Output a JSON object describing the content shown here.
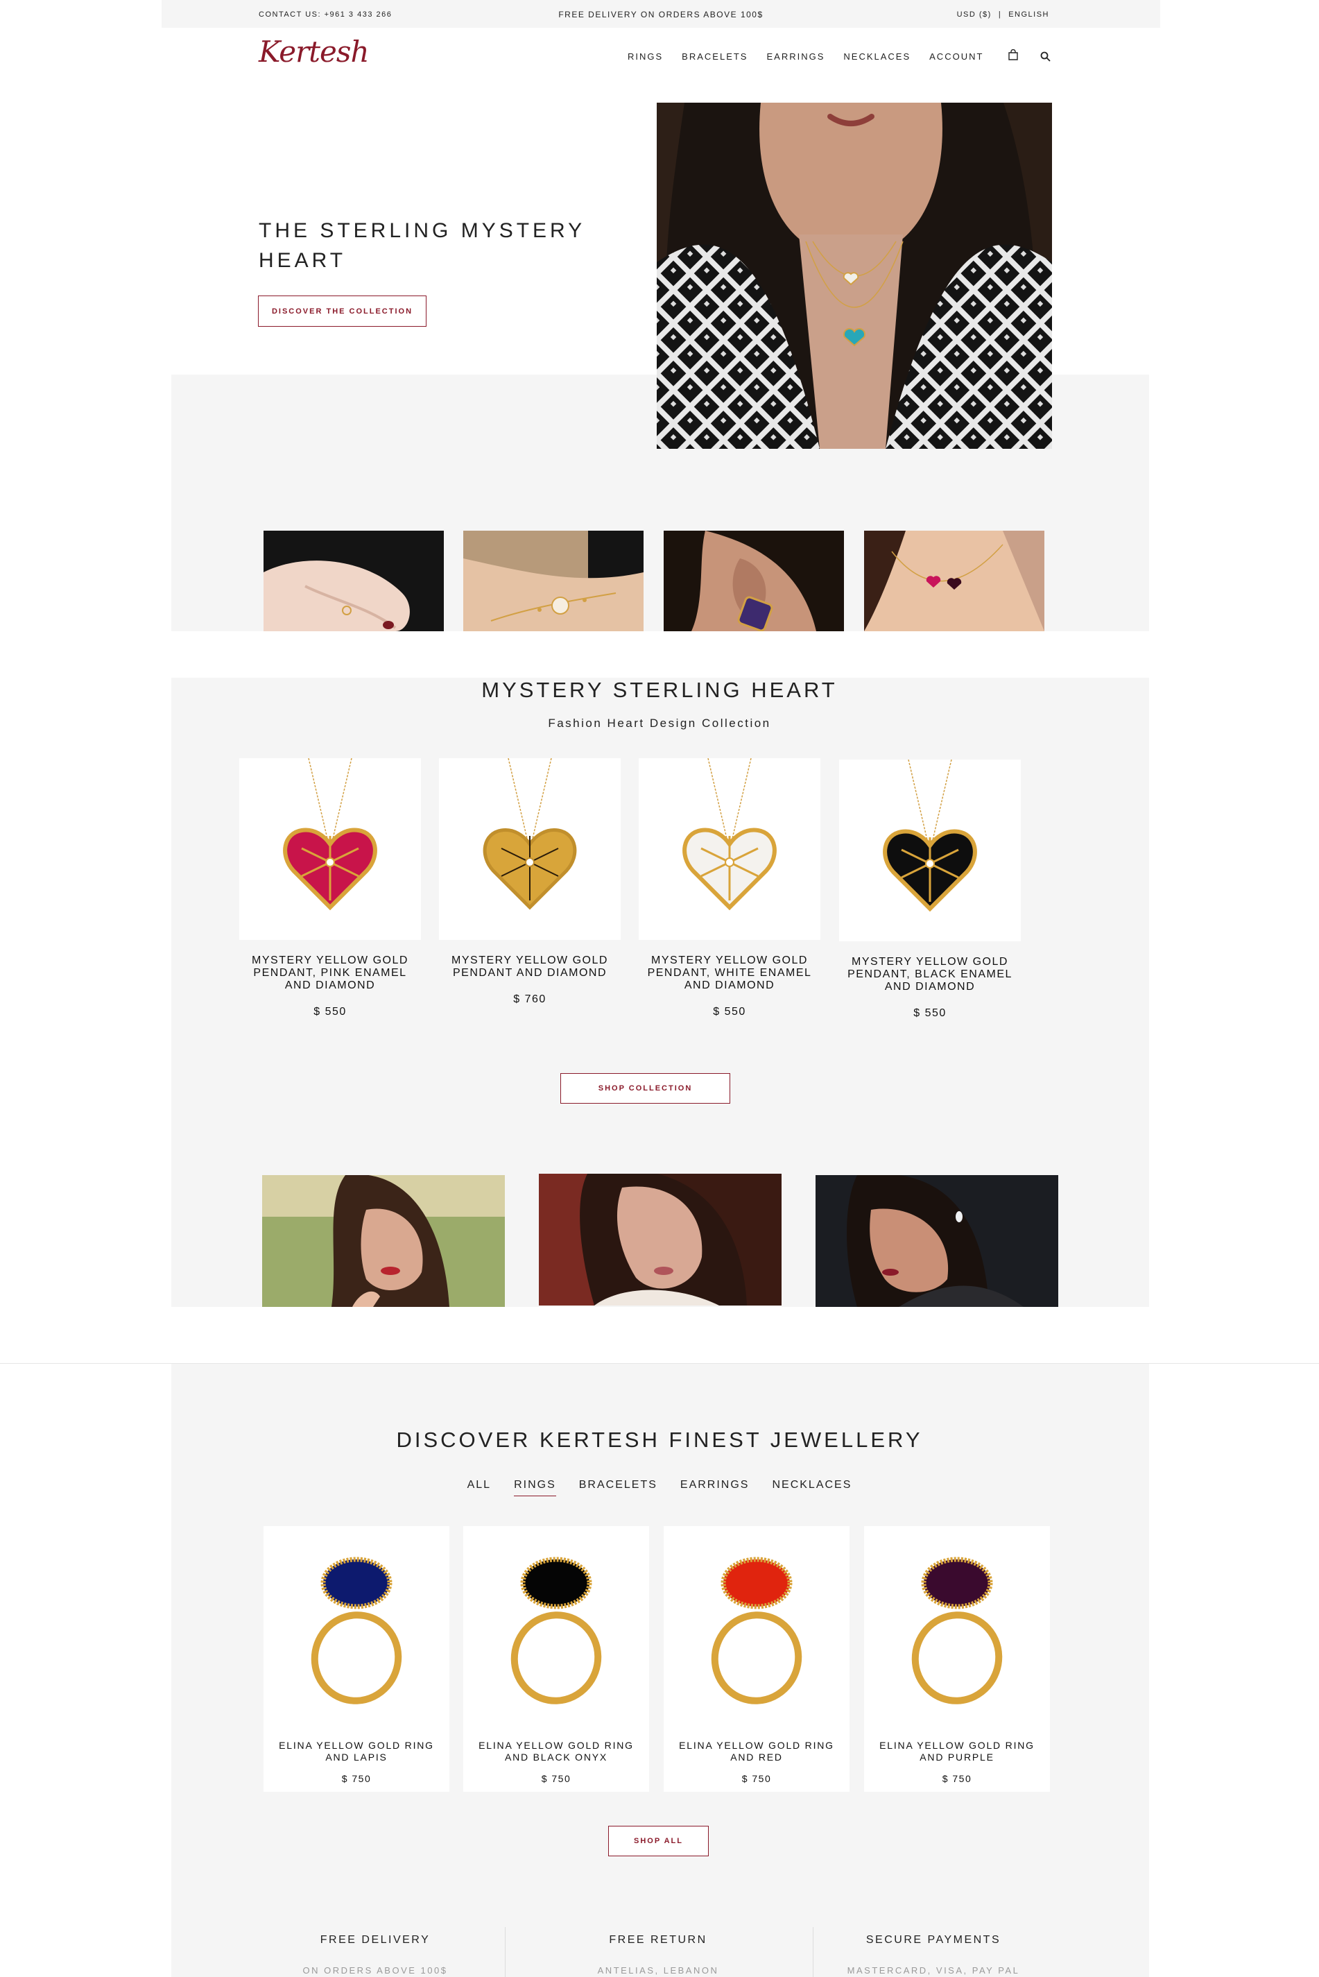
{
  "topbar": {
    "contact": "CONTACT US: +961 3 433 266",
    "delivery": "FREE DELIVERY ON ORDERS ABOVE 100$",
    "currency": "USD ($)",
    "separator": "|",
    "language": "ENGLISH"
  },
  "header": {
    "logo": "Kertesh",
    "nav": [
      "RINGS",
      "BRACELETS",
      "EARRINGS",
      "NECKLACES",
      "ACCOUNT"
    ],
    "icons": [
      "shopping-bag-icon",
      "search-icon"
    ]
  },
  "hero": {
    "title": "THE STERLING MYSTERY HEART",
    "button": "DISCOVER THE COLLECTION"
  },
  "mystery": {
    "title": "MYSTERY STERLING HEART",
    "subtitle": "Fashion Heart Design Collection",
    "products": [
      {
        "name": "MYSTERY YELLOW GOLD PENDANT, PINK ENAMEL AND DIAMOND",
        "price": "$ 550",
        "color": "#c8144a"
      },
      {
        "name": "MYSTERY YELLOW GOLD PENDANT AND DIAMOND",
        "price": "$ 760",
        "color": "#d8a53a"
      },
      {
        "name": "MYSTERY YELLOW GOLD PENDANT, WHITE ENAMEL AND DIAMOND",
        "price": "$ 550",
        "color": "#f4f2ee"
      },
      {
        "name": "MYSTERY YELLOW GOLD PENDANT, BLACK ENAMEL AND DIAMOND",
        "price": "$ 550",
        "color": "#0e0e0e"
      }
    ],
    "button": "SHOP COLLECTION"
  },
  "discover": {
    "title": "DISCOVER KERTESH FINEST JEWELLERY",
    "tabs": [
      "ALL",
      "RINGS",
      "BRACELETS",
      "EARRINGS",
      "NECKLACES"
    ],
    "active_tab": "RINGS",
    "products": [
      {
        "name": "ELINA YELLOW GOLD RING AND LAPIS",
        "price": "$ 750",
        "color": "#0d1a6e"
      },
      {
        "name": "ELINA YELLOW GOLD RING AND BLACK ONYX",
        "price": "$ 750",
        "color": "#050505"
      },
      {
        "name": "ELINA YELLOW GOLD RING AND RED",
        "price": "$ 750",
        "color": "#e0240e"
      },
      {
        "name": "ELINA YELLOW GOLD RING AND PURPLE",
        "price": "$ 750",
        "color": "#3a0a2e"
      }
    ],
    "button": "SHOP ALL"
  },
  "features": [
    {
      "title": "FREE DELIVERY",
      "subtitle": "ON ORDERS ABOVE 100$"
    },
    {
      "title": "FREE RETURN",
      "subtitle": "ANTELIAS, LEBANON"
    },
    {
      "title": "SECURE PAYMENTS",
      "subtitle": "MASTERCARD, VISA, PAY PAL"
    }
  ],
  "colors": {
    "brand": "#8a1a2a",
    "section_bg": "#f5f5f5",
    "gold": "#d9a43a"
  }
}
